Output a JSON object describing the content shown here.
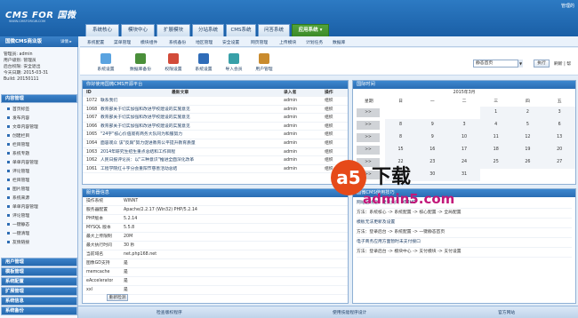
{
  "header": {
    "logo": "CMS FOR 国微",
    "logo_sub": "WWW.CMSFORGW.COM",
    "user_corner": "管理的"
  },
  "tabs": [
    "系统核心",
    "模块中心",
    "扩展模块",
    "分站系统",
    "CMS系统",
    "问答系统",
    "应用系统 ▾"
  ],
  "active_tab": 6,
  "subnav": [
    "系统配置",
    "菜单管理",
    "模块组件",
    "系统备份",
    "地区管理",
    "安全设置",
    "网页管理",
    "上传模块",
    "计划任务",
    "数据库"
  ],
  "left_panel": {
    "title": "国微CMS商业版",
    "help": "详情 ▸",
    "userinfo": [
      "管理员: admin",
      "用户级别: 管理员",
      "后台权限: 安全退出",
      "今天日期: 2015-03-31",
      "Build: 20150111"
    ],
    "sections": [
      {
        "label": "内容管理",
        "dark": true
      },
      {
        "label": "用户管理",
        "dark": true
      },
      {
        "label": "模板管理",
        "dark": true
      },
      {
        "label": "系统配置",
        "dark": true
      },
      {
        "label": "扩展管理",
        "dark": true
      },
      {
        "label": "系统信息",
        "dark": true
      },
      {
        "label": "系统备份",
        "dark": true
      }
    ],
    "items": [
      "首页标签",
      "发布内容",
      "文章内容管理",
      "创建栏目",
      "栏目管理",
      "系统专题",
      "单单内容管理",
      "评论管理",
      "栏目管理",
      "图片管理",
      "系统来源",
      "单单内容管理",
      "评论管理",
      "一键静态",
      "一键清理",
      "友情链接"
    ]
  },
  "toolbar": {
    "tools": [
      {
        "label": "系统设置",
        "color": "#5aa3e0",
        "icon": "gear-icon"
      },
      {
        "label": "数据库备份",
        "color": "#4a8f3a",
        "icon": "database-icon"
      },
      {
        "label": "权限设置",
        "color": "#d24b3a",
        "icon": "key-icon"
      },
      {
        "label": "系统设置",
        "color": "#2f6cb8",
        "icon": "settings-icon"
      },
      {
        "label": "导入会员",
        "color": "#38a0a8",
        "icon": "import-icon"
      },
      {
        "label": "用户管理",
        "color": "#c98b2e",
        "icon": "user-icon"
      }
    ],
    "select_value": "静态首页",
    "exec_label": "执行",
    "close_count": "刷新 | 帮"
  },
  "articles_panel": {
    "title": "你好使用国微CMS开源平台",
    "headers": [
      "ID",
      "最新文章",
      "录入者",
      "操作"
    ],
    "rows": [
      [
        "1072",
        "联系我们",
        "admin",
        "组织"
      ],
      [
        "1068",
        "教育部关于切实加强和改进学校建设的实施意见",
        "admin",
        "组织"
      ],
      [
        "1067",
        "教育部关于切实加强和改进学校建设的实施意见",
        "admin",
        "组织"
      ],
      [
        "1066",
        "教育部关于切实加强和改进学校建设的实施意见",
        "admin",
        "组织"
      ],
      [
        "1065",
        "\"24字\"核心价值观有商务大队同为和服努力",
        "admin",
        "组织"
      ],
      [
        "1064",
        "面容观众 该\"反腐\"努力促进教育公平提升教育质量",
        "admin",
        "组织"
      ],
      [
        "1063",
        "2014年研究生招生重点总结和工作目程",
        "admin",
        "组织"
      ],
      [
        "1062",
        "人民日报评论员：以\"三种意识\"推进全面深化改革",
        "admin",
        "组织"
      ],
      [
        "1061",
        "工程学院红十字分会重阳节慈善活动总结",
        "admin",
        "组织"
      ]
    ]
  },
  "calendar": {
    "title": "国际时间",
    "month_label": "2015年3月",
    "week_header": [
      "星期",
      "日",
      "一",
      "二",
      "三",
      "四",
      "五"
    ],
    "rows": [
      [
        ">>",
        "",
        "",
        "",
        "1",
        "2",
        "3"
      ],
      [
        ">>",
        "8",
        "9",
        "3",
        "4",
        "5",
        "6"
      ],
      [
        ">>",
        "8",
        "9",
        "10",
        "11",
        "12",
        "13"
      ],
      [
        ">>",
        "15",
        "16",
        "17",
        "18",
        "19",
        "20"
      ],
      [
        ">>",
        "22",
        "23",
        "24",
        "25",
        "26",
        "27"
      ],
      [
        ">>",
        "29",
        "30",
        "31",
        "",
        "",
        ""
      ]
    ]
  },
  "server_panel": {
    "title": "服务器信息",
    "rows": [
      [
        "操作系统",
        "WINNT"
      ],
      [
        "服务器配置",
        "Apache/2.2.17 (Win32) PHP/5.2.14"
      ],
      [
        "PHP版本",
        "5.2.14"
      ],
      [
        "MYSQL 版本",
        "5.5.8"
      ],
      [
        "最大上传限制",
        "20M"
      ],
      [
        "最大执行时间",
        "30 秒"
      ],
      [
        "当前域名",
        "net.php168.net"
      ],
      [
        "图像GD支持",
        "是"
      ],
      [
        "memcache",
        "是"
      ],
      [
        "eAccelerator",
        "是"
      ],
      [
        "xxl",
        "是"
      ]
    ],
    "check_button": "重新检测"
  },
  "tips_panel": {
    "title": "国微CMS使用技巧",
    "lines": [
      "网站上线后，建议关闭 DEBUG",
      "方法：系统核心 -> 系统配置 -> 核心配置 -> 全局配置",
      "模板无法更新及设置",
      "方法：登录后台 -> 系统配置 -> 一键静态首页",
      "电子商务应用方面暂时未支付接口",
      "方法：登录后台 -> 模块中心 -> 支付模块 -> 支付设置"
    ]
  },
  "footer": {
    "cells": [
      "检查版权程序",
      "使用技能程序设计",
      "官方网站"
    ]
  },
  "watermark": {
    "brand": "a5",
    "suffix": "下载",
    "url": "admin5.com"
  }
}
